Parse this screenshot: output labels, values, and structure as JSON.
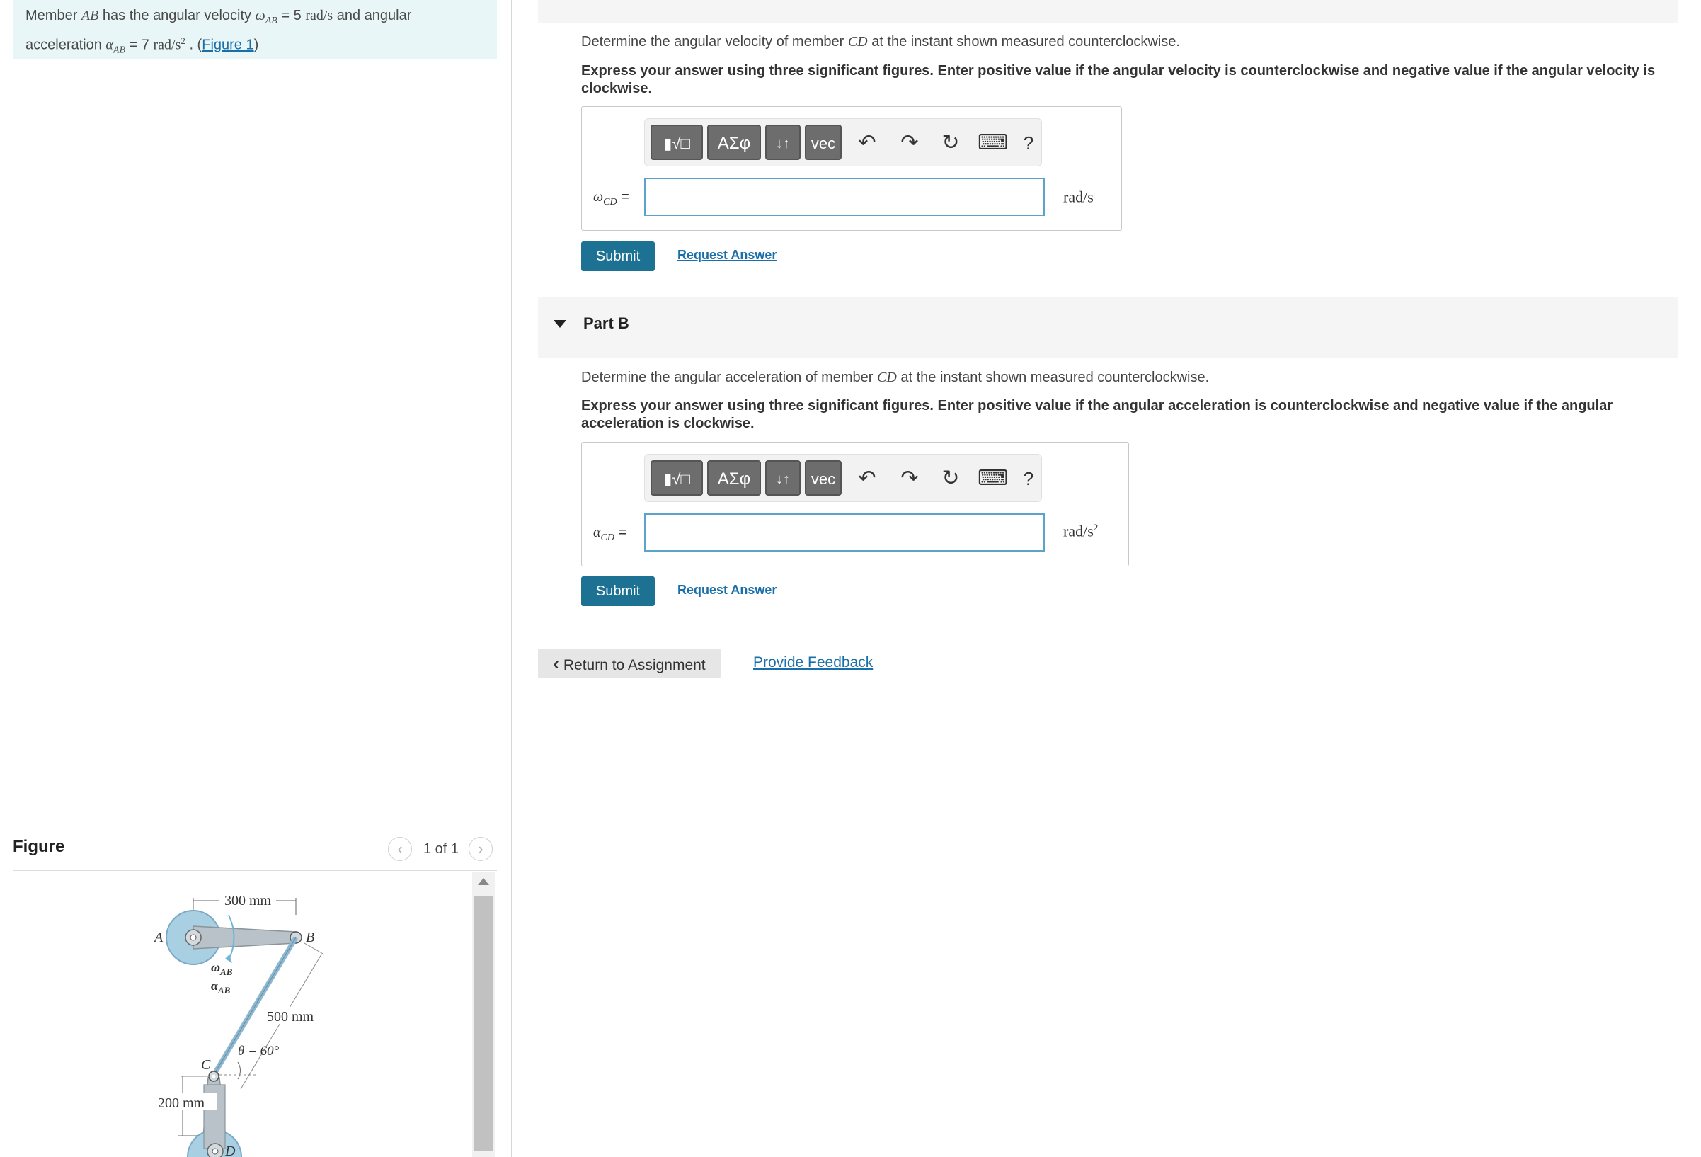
{
  "problem": {
    "t1": "Member ",
    "ab": "AB",
    "t2": " has the angular velocity ",
    "omega": "ω",
    "omega_sub": "AB",
    "t3": " = 5 ",
    "vel_unit": "rad/s",
    "t4": " and angular",
    "t5": "acceleration ",
    "alpha": "α",
    "alpha_sub": "AB",
    "t6": " = 7 ",
    "acc_unit": "rad/s",
    "acc_exp": "2",
    "t7": " . (",
    "figure_link": "Figure 1",
    "t8": ")"
  },
  "figure": {
    "title": "Figure",
    "counter": "1 of 1",
    "prev": "‹",
    "next": "›",
    "labels": {
      "dim_300": "300 mm",
      "A": "A",
      "B": "B",
      "C": "C",
      "D": "D",
      "omega_ab": "ω",
      "omega_ab_sub": "AB",
      "alpha_ab": "α",
      "alpha_ab_sub": "AB",
      "dim_500": "500 mm",
      "theta": "θ = 60°",
      "dim_200": "200 mm"
    }
  },
  "partA": {
    "question_pre": "Determine the angular velocity of member ",
    "member": "CD",
    "question_post": " at the instant shown measured counterclockwise.",
    "instructions": "Express your answer using three significant figures. Enter positive value if the angular velocity is counterclockwise and negative value if the angular velocity is clockwise.",
    "label_symbol": "ω",
    "label_sub": "CD",
    "label_eq": " =",
    "unit": "rad/s",
    "unit_exp": "",
    "input_value": "",
    "submit": "Submit",
    "request": "Request Answer"
  },
  "partB": {
    "title": "Part B",
    "question_pre": "Determine the angular acceleration of member ",
    "member": "CD",
    "question_post": " at the instant shown measured counterclockwise.",
    "instructions": "Express your answer using three significant figures. Enter positive value if the angular acceleration is counterclockwise and negative value if the angular acceleration is clockwise.",
    "label_symbol": "α",
    "label_sub": "CD",
    "label_eq": " =",
    "unit": "rad/s",
    "unit_exp": "2",
    "input_value": "",
    "submit": "Submit",
    "request": "Request Answer"
  },
  "toolbar": {
    "templates": "▮√□",
    "greek": "ΑΣφ",
    "arrows": "↓↑",
    "vec": "vec",
    "undo": "↶",
    "redo": "↷",
    "reset": "↻",
    "keyboard": "⌨",
    "help": "?"
  },
  "footer": {
    "return": "Return to Assignment",
    "return_icon": "‹",
    "feedback": "Provide Feedback"
  },
  "colors": {
    "problem_bg": "#e8f6f7",
    "accent": "#1d7193",
    "link": "#1a6fa8",
    "wheel": "#a9cfe3"
  }
}
